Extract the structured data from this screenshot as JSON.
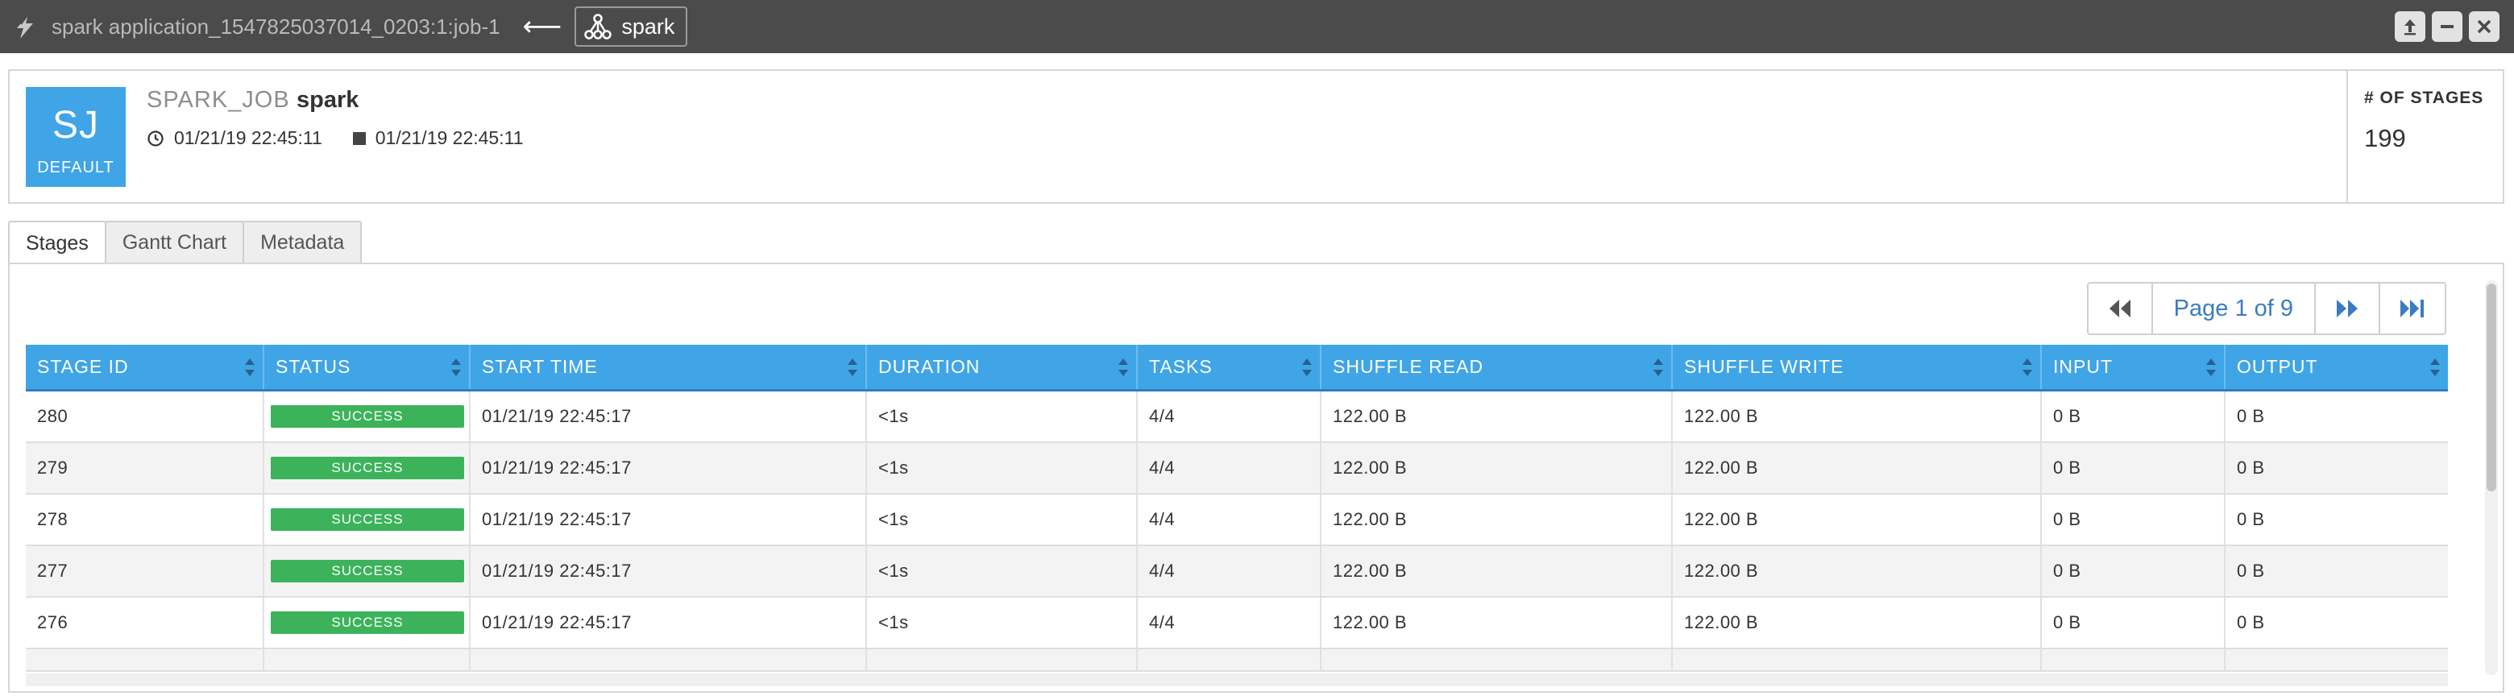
{
  "titlebar": {
    "title": "spark application_1547825037014_0203:1:job-1",
    "arrow": "⟵",
    "node_label": "spark",
    "icons": [
      "lightning-icon",
      "node-tree-icon",
      "upload-icon",
      "minimize-icon",
      "close-icon"
    ]
  },
  "header": {
    "avatar_initials": "SJ",
    "avatar_label": "DEFAULT",
    "avatar_color": "#3fa5e6",
    "entity_type": "SPARK_JOB",
    "entity_name": "spark",
    "start_time": "01/21/19 22:45:11",
    "end_time": "01/21/19 22:45:11",
    "stat_label": "# OF STAGES",
    "stat_value": "199"
  },
  "tabs": [
    {
      "label": "Stages",
      "active": true
    },
    {
      "label": "Gantt Chart",
      "active": false
    },
    {
      "label": "Metadata",
      "active": false
    }
  ],
  "pagination": {
    "text": "Page 1 of 9"
  },
  "table": {
    "columns": [
      "STAGE ID",
      "STATUS",
      "START TIME",
      "DURATION",
      "TASKS",
      "SHUFFLE READ",
      "SHUFFLE WRITE",
      "INPUT",
      "OUTPUT"
    ],
    "rows": [
      [
        "280",
        "SUCCESS",
        "01/21/19 22:45:17",
        "<1s",
        "4/4",
        "122.00 B",
        "122.00 B",
        "0 B",
        "0 B"
      ],
      [
        "279",
        "SUCCESS",
        "01/21/19 22:45:17",
        "<1s",
        "4/4",
        "122.00 B",
        "122.00 B",
        "0 B",
        "0 B"
      ],
      [
        "278",
        "SUCCESS",
        "01/21/19 22:45:17",
        "<1s",
        "4/4",
        "122.00 B",
        "122.00 B",
        "0 B",
        "0 B"
      ],
      [
        "277",
        "SUCCESS",
        "01/21/19 22:45:17",
        "<1s",
        "4/4",
        "122.00 B",
        "122.00 B",
        "0 B",
        "0 B"
      ],
      [
        "276",
        "SUCCESS",
        "01/21/19 22:45:17",
        "<1s",
        "4/4",
        "122.00 B",
        "122.00 B",
        "0 B",
        "0 B"
      ]
    ],
    "status_color": "#3cb35b",
    "header_color": "#3fa5e6"
  }
}
